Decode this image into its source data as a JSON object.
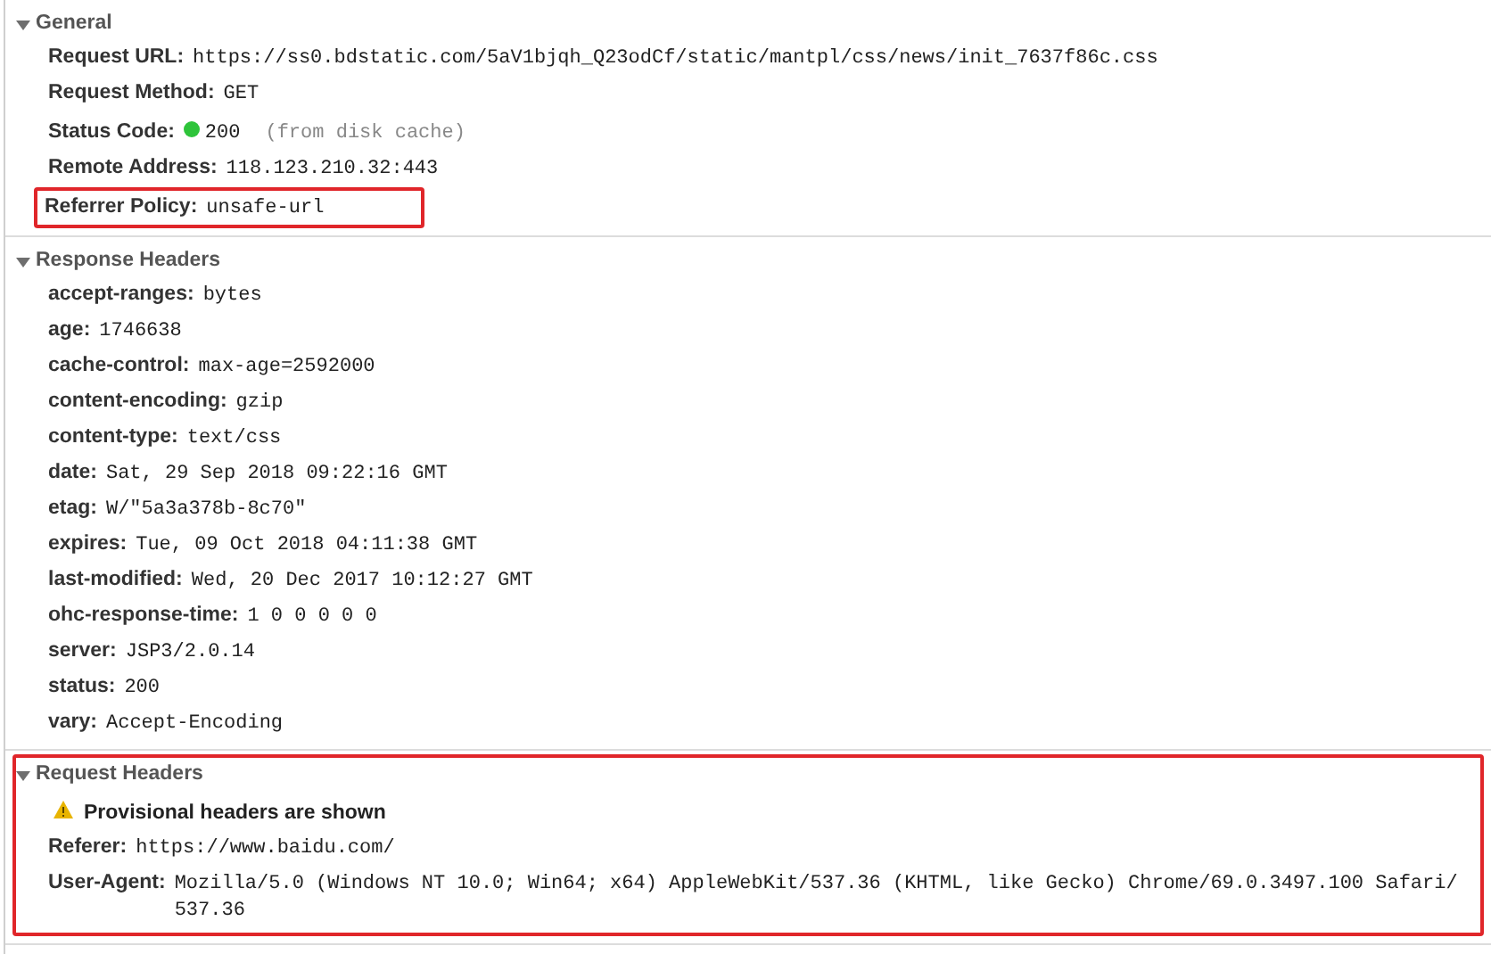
{
  "sections": [
    {
      "title": "General",
      "expanded": true,
      "highlighted": false,
      "rows": [
        {
          "kind": "header",
          "name": "Request URL:",
          "value": "https://ss0.bdstatic.com/5aV1bjqh_Q23odCf/static/mantpl/css/news/init_7637f86c.css",
          "highlighted": false
        },
        {
          "kind": "header",
          "name": "Request Method:",
          "value": "GET",
          "highlighted": false
        },
        {
          "kind": "status",
          "name": "Status Code:",
          "value": "200",
          "note": "(from disk cache)",
          "highlighted": false
        },
        {
          "kind": "header",
          "name": "Remote Address:",
          "value": "118.123.210.32:443",
          "highlighted": false
        },
        {
          "kind": "header",
          "name": "Referrer Policy:",
          "value": "unsafe-url",
          "highlighted": true
        }
      ]
    },
    {
      "title": "Response Headers",
      "expanded": true,
      "highlighted": false,
      "rows": [
        {
          "kind": "header",
          "name": "accept-ranges:",
          "value": "bytes",
          "highlighted": false
        },
        {
          "kind": "header",
          "name": "age:",
          "value": "1746638",
          "highlighted": false
        },
        {
          "kind": "header",
          "name": "cache-control:",
          "value": "max-age=2592000",
          "highlighted": false
        },
        {
          "kind": "header",
          "name": "content-encoding:",
          "value": "gzip",
          "highlighted": false
        },
        {
          "kind": "header",
          "name": "content-type:",
          "value": "text/css",
          "highlighted": false
        },
        {
          "kind": "header",
          "name": "date:",
          "value": "Sat, 29 Sep 2018 09:22:16 GMT",
          "highlighted": false
        },
        {
          "kind": "header",
          "name": "etag:",
          "value": "W/\"5a3a378b-8c70\"",
          "highlighted": false
        },
        {
          "kind": "header",
          "name": "expires:",
          "value": "Tue, 09 Oct 2018 04:11:38 GMT",
          "highlighted": false
        },
        {
          "kind": "header",
          "name": "last-modified:",
          "value": "Wed, 20 Dec 2017 10:12:27 GMT",
          "highlighted": false
        },
        {
          "kind": "header",
          "name": "ohc-response-time:",
          "value": "1 0 0 0 0 0",
          "highlighted": false
        },
        {
          "kind": "header",
          "name": "server:",
          "value": "JSP3/2.0.14",
          "highlighted": false
        },
        {
          "kind": "header",
          "name": "status:",
          "value": "200",
          "highlighted": false
        },
        {
          "kind": "header",
          "name": "vary:",
          "value": "Accept-Encoding",
          "highlighted": false
        }
      ]
    },
    {
      "title": "Request Headers",
      "expanded": true,
      "highlighted": true,
      "rows": [
        {
          "kind": "warning",
          "text": "Provisional headers are shown",
          "highlighted": false
        },
        {
          "kind": "header",
          "name": "Referer:",
          "value": "https://www.baidu.com/",
          "highlighted": false
        },
        {
          "kind": "header",
          "name": "User-Agent:",
          "value": "Mozilla/5.0 (Windows NT 10.0; Win64; x64) AppleWebKit/537.36 (KHTML, like Gecko) Chrome/69.0.3497.100 Safari/537.36",
          "highlighted": false
        }
      ]
    }
  ]
}
